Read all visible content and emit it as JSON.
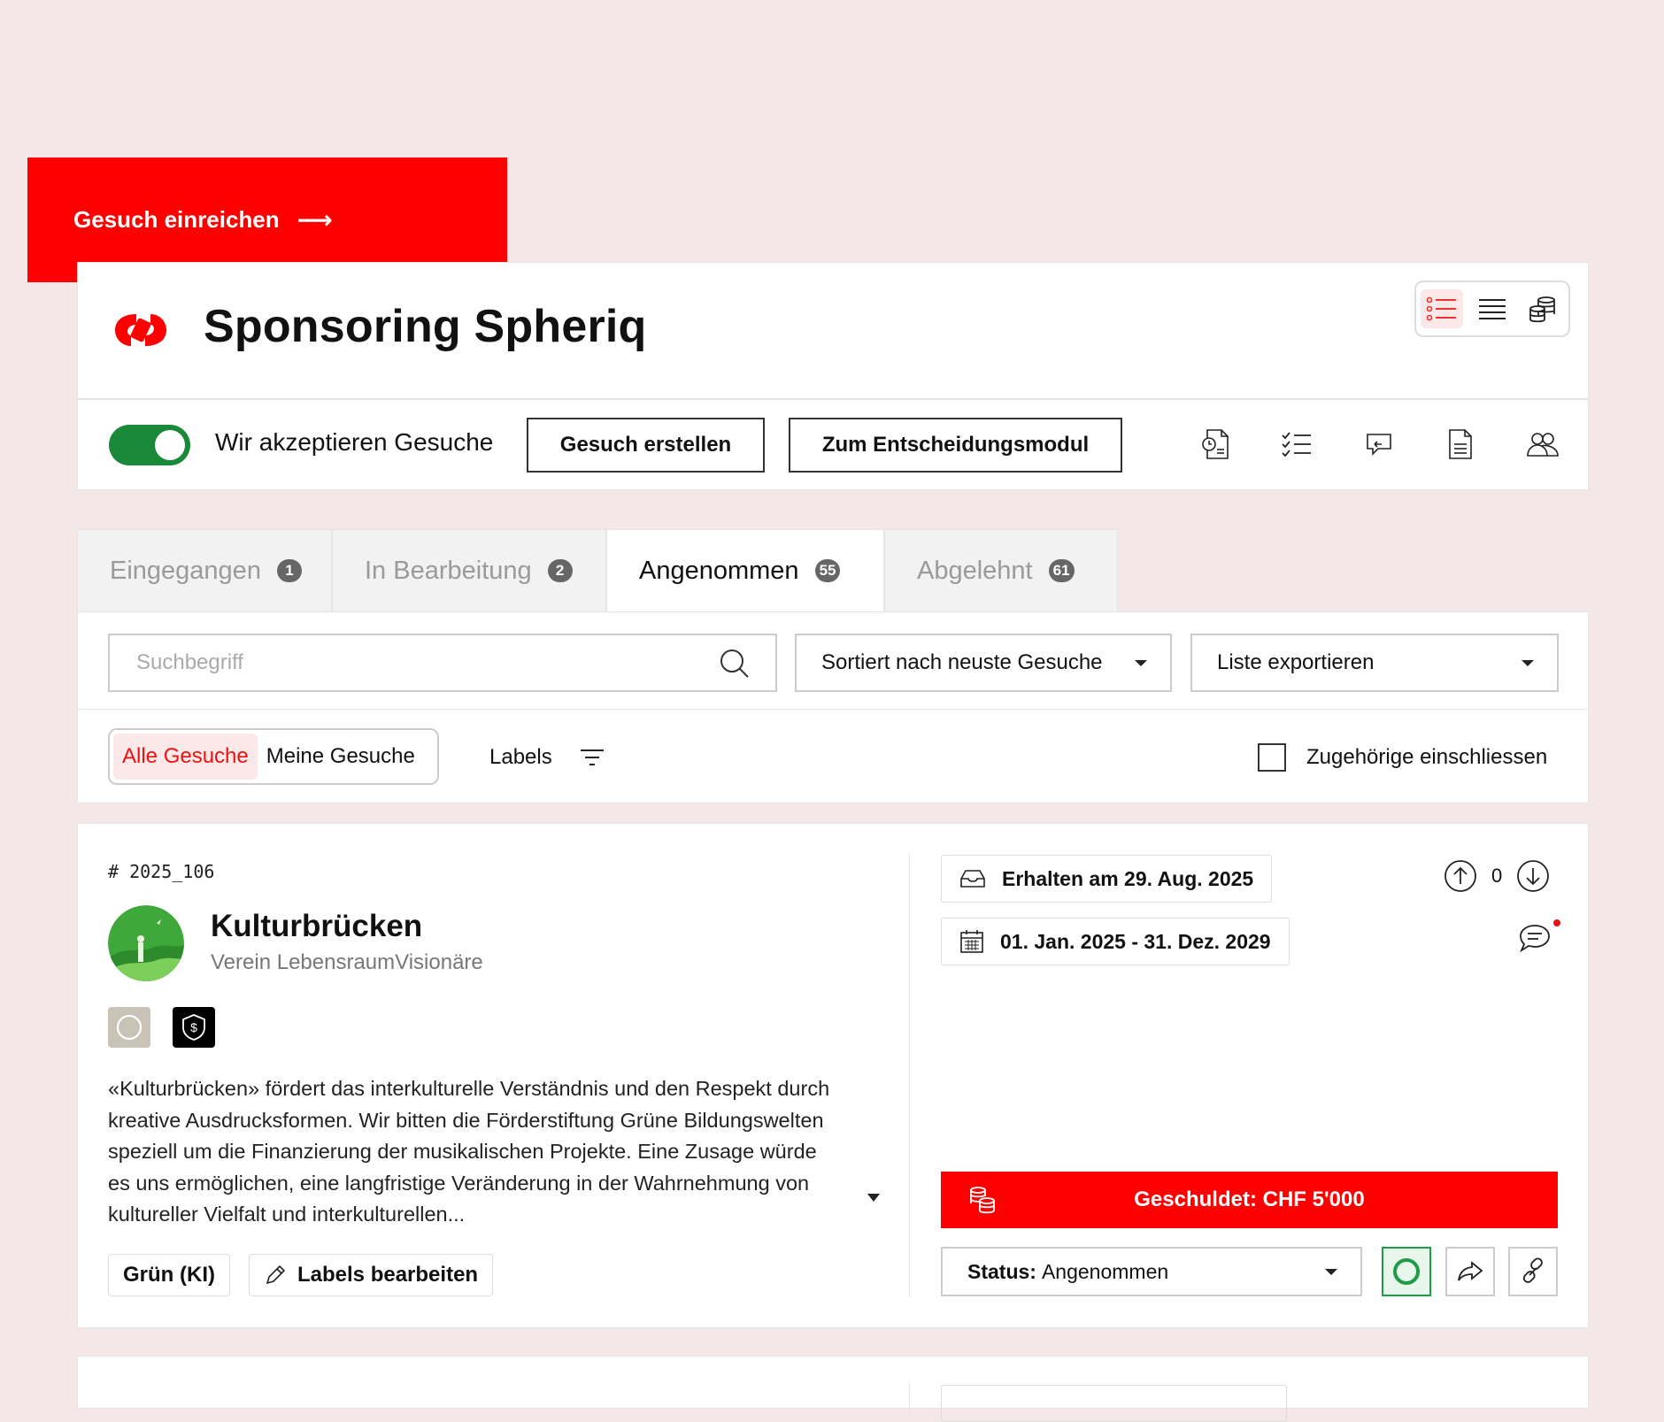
{
  "cta": {
    "label": "Gesuch einreichen",
    "arrow": "⟶"
  },
  "header": {
    "title": "Sponsoring Spheriq",
    "view_modes": [
      "detail-list-icon",
      "compact-list-icon",
      "budget-icon"
    ],
    "colors": {
      "brand": "#ff0000",
      "accent_green": "#1a8a3a"
    }
  },
  "toolbar": {
    "toggle_on": true,
    "toggle_label": "Wir akzeptieren Gesuche",
    "create_button": "Gesuch erstellen",
    "decision_button": "Zum Entscheidungsmodul",
    "icons": [
      "document-clock-icon",
      "checklist-icon",
      "reply-message-icon",
      "document-icon",
      "team-icon"
    ]
  },
  "tabs": [
    {
      "label": "Eingegangen",
      "count": "1",
      "active": false
    },
    {
      "label": "In Bearbeitung",
      "count": "2",
      "active": false
    },
    {
      "label": "Angenommen",
      "count": "55",
      "active": true
    },
    {
      "label": "Abgelehnt",
      "count": "61",
      "active": false
    }
  ],
  "filters": {
    "search_placeholder": "Suchbegriff",
    "sort_value": "Sortiert nach neuste Gesuche",
    "export_value": "Liste exportieren",
    "scope_all": "Alle Gesuche",
    "scope_mine": "Meine Gesuche",
    "labels": "Labels",
    "include_related": "Zugehörige einschliessen",
    "include_related_checked": false
  },
  "card": {
    "id": "# 2025_106",
    "title": "Kulturbrücken",
    "org": "Verein LebensraumVisionäre",
    "description": "«Kulturbrücken» fördert das interkulturelle Verständnis und den Respekt durch kreative Ausdrucksformen. Wir bitten die Förderstiftung Grüne Bildungswelten speziell um die Finanzierung der musikalischen Projekte. Eine Zusage würde es uns ermöglichen, eine langfristige Veränderung in der Wahrnehmung von kultureller Vielfalt und interkulturellen...",
    "label_chip": "Grün (KI)",
    "edit_labels": "Labels bearbeiten",
    "received": "Erhalten am 29. Aug. 2025",
    "period": "01. Jan. 2025 - 31. Dez. 2029",
    "votes": "0",
    "owed": "Geschuldet: CHF 5'000",
    "status_label": "Status:",
    "status_value": "Angenommen"
  }
}
